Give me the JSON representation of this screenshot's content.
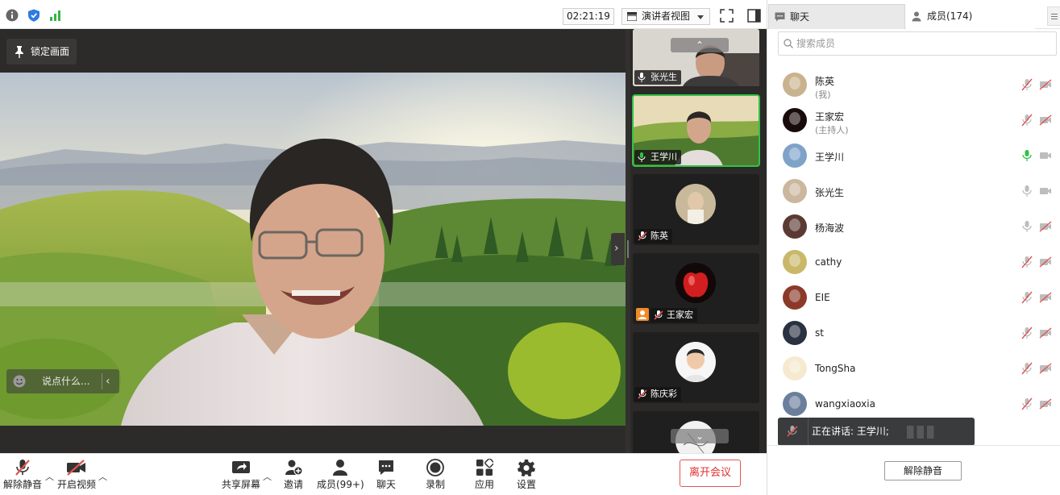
{
  "topbar": {
    "timer": "02:21:19",
    "view_mode": "演讲者视图",
    "icons": [
      "info-icon",
      "shield-icon",
      "signal-icon",
      "fullscreen-icon",
      "layout-icon"
    ]
  },
  "main_video": {
    "lock_label": "锁定画面",
    "chat_placeholder": "说点什么..."
  },
  "thumbnails": [
    {
      "name": "张光生",
      "mic": "on"
    },
    {
      "name": "王学川",
      "mic": "active",
      "active": true
    },
    {
      "name": "陈英",
      "mic": "muted"
    },
    {
      "name": "王家宏",
      "mic": "muted",
      "host": true
    },
    {
      "name": "陈庆彩",
      "mic": "muted"
    }
  ],
  "toolbar": {
    "unmute_label": "解除静音",
    "start_video_label": "开启视频",
    "share_label": "共享屏幕",
    "invite_label": "邀请",
    "members_label": "成员(99+)",
    "chat_label": "聊天",
    "record_label": "录制",
    "apps_label": "应用",
    "settings_label": "设置",
    "leave_label": "离开会议"
  },
  "right_panel": {
    "tab_chat": "聊天",
    "tab_members": "成员(174)",
    "search_placeholder": "搜索成员",
    "members": [
      {
        "name": "陈英",
        "sub": "(我)",
        "mic": "muted",
        "cam": "off"
      },
      {
        "name": "王家宏",
        "sub": "(主持人)",
        "mic": "muted",
        "cam": "off"
      },
      {
        "name": "王学川",
        "sub": "",
        "mic": "speaking",
        "cam": "on"
      },
      {
        "name": "张光生",
        "sub": "",
        "mic": "on",
        "cam": "on"
      },
      {
        "name": "杨海波",
        "sub": "",
        "mic": "on",
        "cam": "off"
      },
      {
        "name": "cathy",
        "sub": "",
        "mic": "muted",
        "cam": "off"
      },
      {
        "name": "EIE",
        "sub": "",
        "mic": "muted",
        "cam": "off"
      },
      {
        "name": "st",
        "sub": "",
        "mic": "muted",
        "cam": "off"
      },
      {
        "name": "TongSha",
        "sub": "",
        "mic": "muted",
        "cam": "off"
      },
      {
        "name": "wangxiaoxia",
        "sub": "",
        "mic": "muted",
        "cam": "off"
      }
    ],
    "speaking_text": "正在讲话: 王学川;",
    "unmute_all_label": "解除静音"
  },
  "colors": {
    "accent_green": "#31c247",
    "leave_red": "#e02f2f",
    "muted_red": "#e05252",
    "host_orange": "#f08b28"
  }
}
